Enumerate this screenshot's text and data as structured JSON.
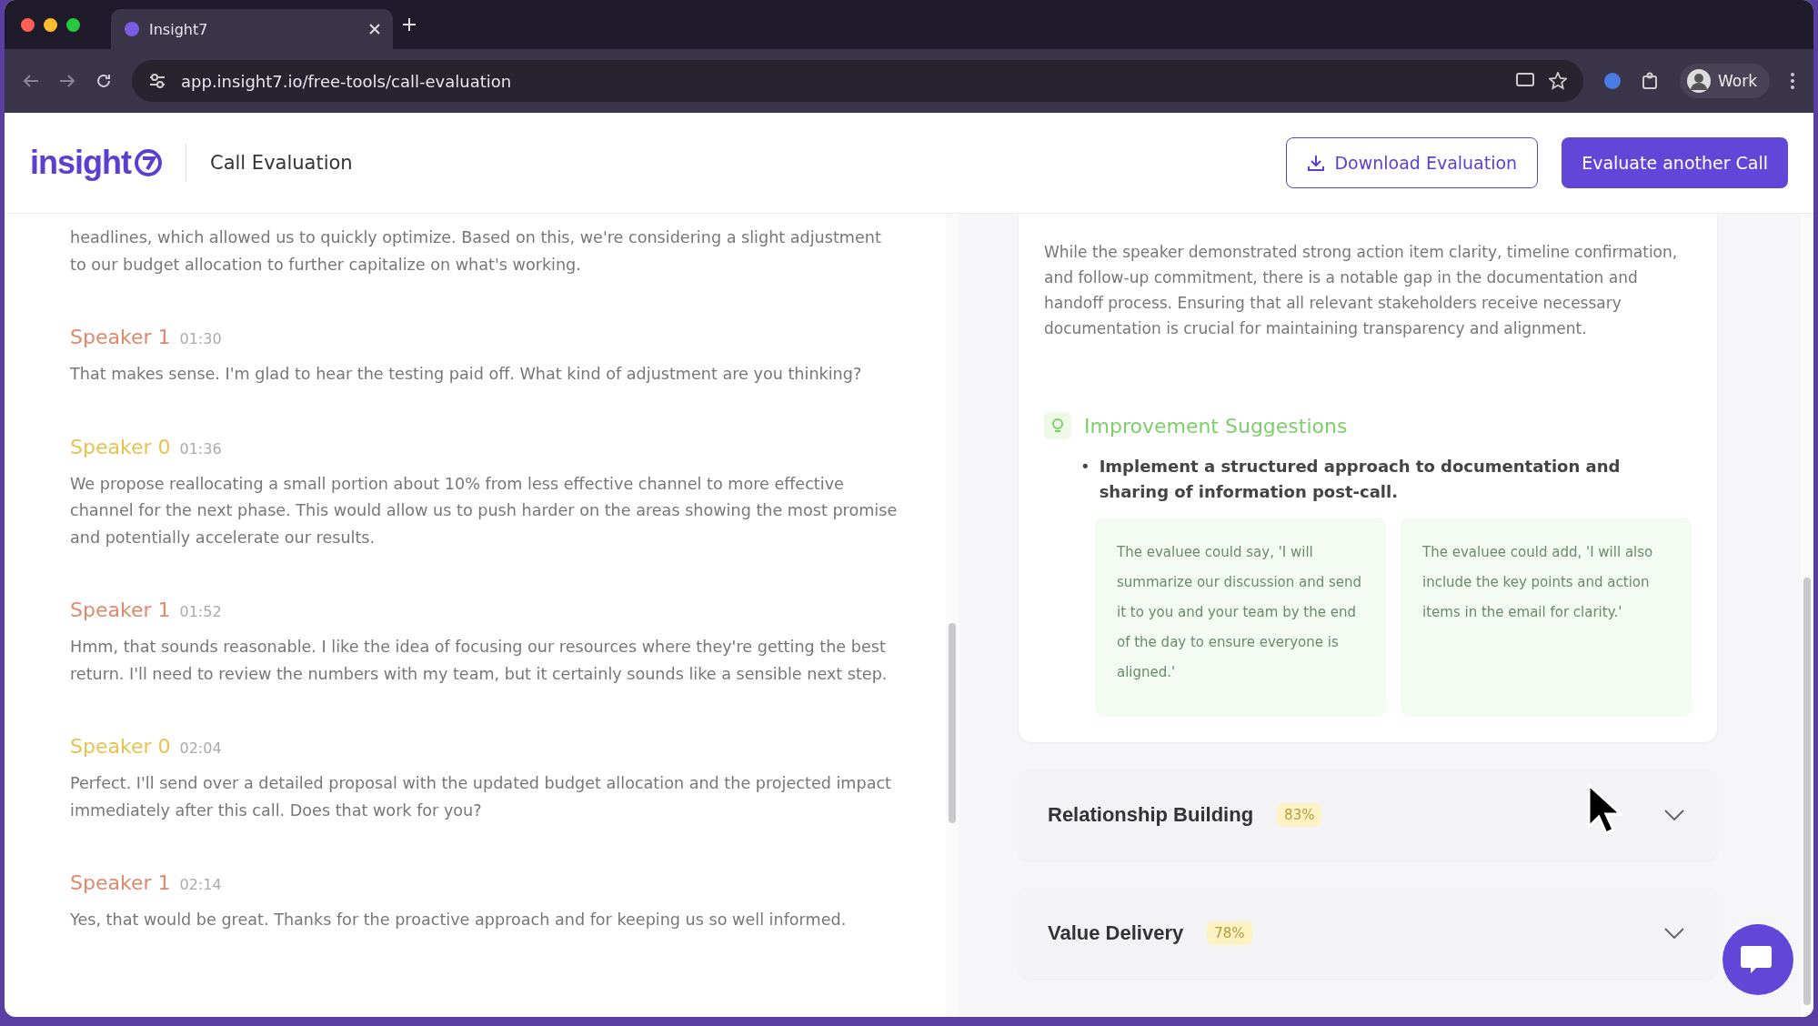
{
  "browser": {
    "tab_title": "Insight7",
    "url": "app.insight7.io/free-tools/call-evaluation",
    "profile": "Work"
  },
  "header": {
    "logo": "insight",
    "page_title": "Call Evaluation",
    "buttons": [
      {
        "label": "Download Evaluation",
        "kind": "outline"
      },
      {
        "label": "Evaluate another Call",
        "kind": "primary"
      }
    ]
  },
  "transcript": [
    {
      "text": "headlines, which allowed us to quickly optimize. Based on this, we're considering a slight adjustment to our budget allocation to further capitalize on what's working."
    },
    {
      "speaker": "Speaker 1",
      "time": "01:30",
      "color": "#e0896b",
      "text": "That makes sense. I'm glad to hear the testing paid off. What kind of adjustment are you thinking?"
    },
    {
      "speaker": "Speaker 0",
      "time": "01:36",
      "color": "#e8c24e",
      "text": "We propose reallocating a small portion about 10% from less effective channel to more effective channel for the next phase. This would allow us to push harder on the areas showing the most promise and potentially accelerate our results."
    },
    {
      "speaker": "Speaker 1",
      "time": "01:52",
      "color": "#e0896b",
      "text": "Hmm, that sounds reasonable. I like the idea of focusing our resources where they're getting the best return. I'll need to review the numbers with my team, but it certainly sounds like a sensible next step."
    },
    {
      "speaker": "Speaker 0",
      "time": "02:04",
      "color": "#e8c24e",
      "text": "Perfect. I'll send over a detailed proposal with the updated budget allocation and the projected impact immediately after this call. Does that work for you?"
    },
    {
      "speaker": "Speaker 1",
      "time": "02:14",
      "color": "#e0896b",
      "text": "Yes, that would be great. Thanks for the proactive approach and for keeping us so well informed."
    }
  ],
  "evaluation": {
    "summary": "While the speaker demonstrated strong action item clarity, timeline confirmation, and follow-up commitment, there is a notable gap in the documentation and handoff process. Ensuring that all relevant stakeholders receive necessary documentation is crucial for maintaining transparency and alignment.",
    "suggestions_title": "Improvement Suggestions",
    "bullet": "•",
    "suggestions": [
      "Implement a structured approach to documentation and sharing of information post-call."
    ],
    "examples": [
      "The evaluee could say, 'I will summarize our discussion and send it to you and your team by the end of the day to ensure everyone is aligned.'",
      "The evaluee could add, 'I will also include the key points and action items in the email for clarity.'"
    ],
    "categories": [
      {
        "name": "Relationship Building",
        "score": "83%"
      },
      {
        "name": "Value Delivery",
        "score": "78%"
      }
    ]
  }
}
